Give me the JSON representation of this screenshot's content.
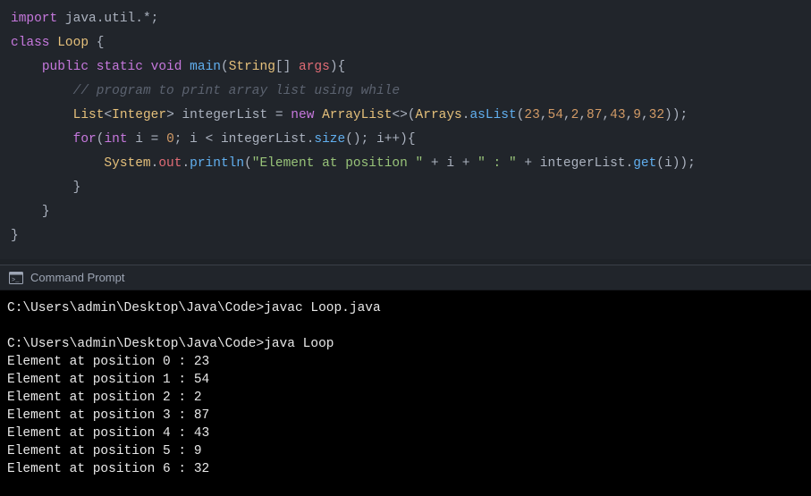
{
  "code": {
    "l1": {
      "import": "import",
      "pkg": "java.util.",
      "star": "*",
      "semi": ";"
    },
    "l2": {
      "class": "class",
      "name": "Loop",
      "brace": "{"
    },
    "l3": {
      "public": "public",
      "static": "static",
      "void": "void",
      "main": "main",
      "lp": "(",
      "type": "String",
      "brackets": "[] ",
      "args": "args",
      "rp": ")",
      "brace": "{"
    },
    "l4": {
      "comment": "// program to print array list using while"
    },
    "l5": {
      "listType": "List",
      "lt": "<",
      "integer": "Integer",
      "gt": "> ",
      "var": "integerList",
      "eq": " = ",
      "new": "new",
      "sp": " ",
      "arraylist": "ArrayList",
      "diamond": "<>(",
      "arrays": "Arrays",
      "dot": ".",
      "asList": "asList",
      "lp": "(",
      "n1": "23",
      "c": ",",
      "n2": "54",
      "n3": "2",
      "n4": "87",
      "n5": "43",
      "n6": "9",
      "n7": "32",
      "rp": "));"
    },
    "l6": {
      "for": "for",
      "lp": "(",
      "int": "int",
      "sp": " ",
      "i": "i",
      "eq": " = ",
      "zero": "0",
      "semi": "; ",
      "i2": "i",
      "lt": " < ",
      "var": "integerList",
      "dot": ".",
      "size": "size",
      "pr": "(); ",
      "i3": "i",
      "inc": "++",
      "rp": ")",
      "brace": "{"
    },
    "l7": {
      "system": "System",
      "d1": ".",
      "out": "out",
      "d2": ".",
      "println": "println",
      "lp": "(",
      "s1": "\"Element at position \"",
      "p1": " + ",
      "i": "i",
      "p2": " + ",
      "s2": "\" : \"",
      "p3": " + ",
      "var": "integerList",
      "d3": ".",
      "get": "get",
      "lp2": "(",
      "i2": "i",
      "rp": "));"
    },
    "l8": {
      "brace": "}"
    },
    "l9": {
      "brace": "}"
    },
    "l10": {
      "brace": "}"
    }
  },
  "terminal": {
    "title": "Command Prompt",
    "prompt": "C:\\Users\\admin\\Desktop\\Java\\Code>",
    "cmd1": "javac Loop.java",
    "cmd2": "java Loop",
    "out": [
      "Element at position 0 : 23",
      "Element at position 1 : 54",
      "Element at position 2 : 2",
      "Element at position 3 : 87",
      "Element at position 4 : 43",
      "Element at position 5 : 9",
      "Element at position 6 : 32"
    ]
  }
}
